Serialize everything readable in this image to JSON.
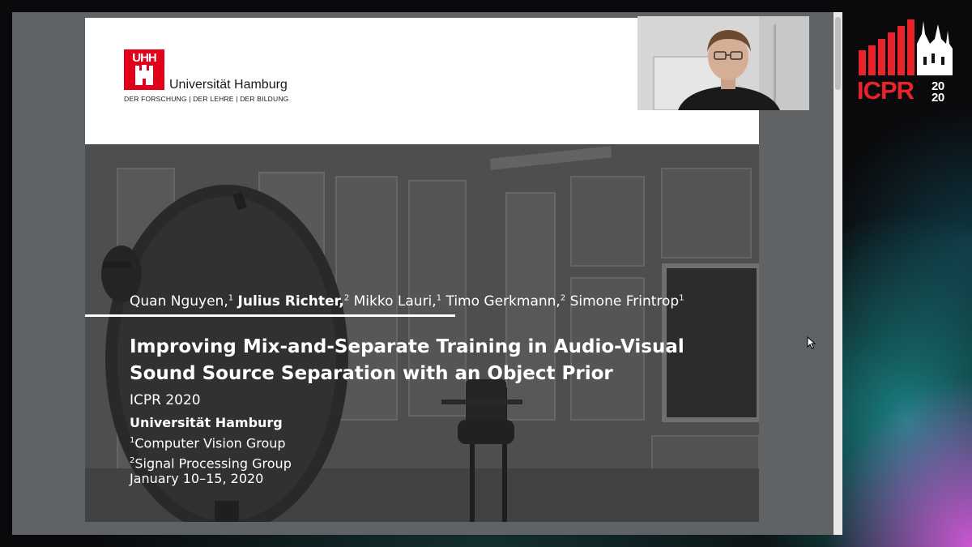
{
  "university": {
    "logo_text": "UHH",
    "name": "Universität Hamburg",
    "tagline": "DER FORSCHUNG | DER LEHRE | DER BILDUNG"
  },
  "authors": [
    {
      "name": "Quan Nguyen,",
      "sup": "1",
      "bold": false
    },
    {
      "name": "Julius Richter,",
      "sup": "2",
      "bold": true
    },
    {
      "name": "Mikko Lauri,",
      "sup": "1",
      "bold": false
    },
    {
      "name": "Timo Gerkmann,",
      "sup": "2",
      "bold": false
    },
    {
      "name": "Simone Frintrop",
      "sup": "1",
      "bold": false
    }
  ],
  "title_line1": "Improving Mix-and-Separate Training in Audio-Visual",
  "title_line2": "Sound Source Separation with an Object Prior",
  "conference": "ICPR 2020",
  "institution": "Universität Hamburg",
  "groups": [
    {
      "sup": "1",
      "name": "Computer Vision Group"
    },
    {
      "sup": "2",
      "name": "Signal Processing Group"
    }
  ],
  "date": "January 10–15, 2020",
  "icpr_logo": {
    "text": "ICPR",
    "year_top": "20",
    "year_bottom": "20"
  },
  "colors": {
    "uhh_red": "#e2001a",
    "icpr_red": "#e8242a"
  },
  "icons": {
    "cursor": "mouse-pointer-icon",
    "webcam": "presenter-video-icon"
  }
}
